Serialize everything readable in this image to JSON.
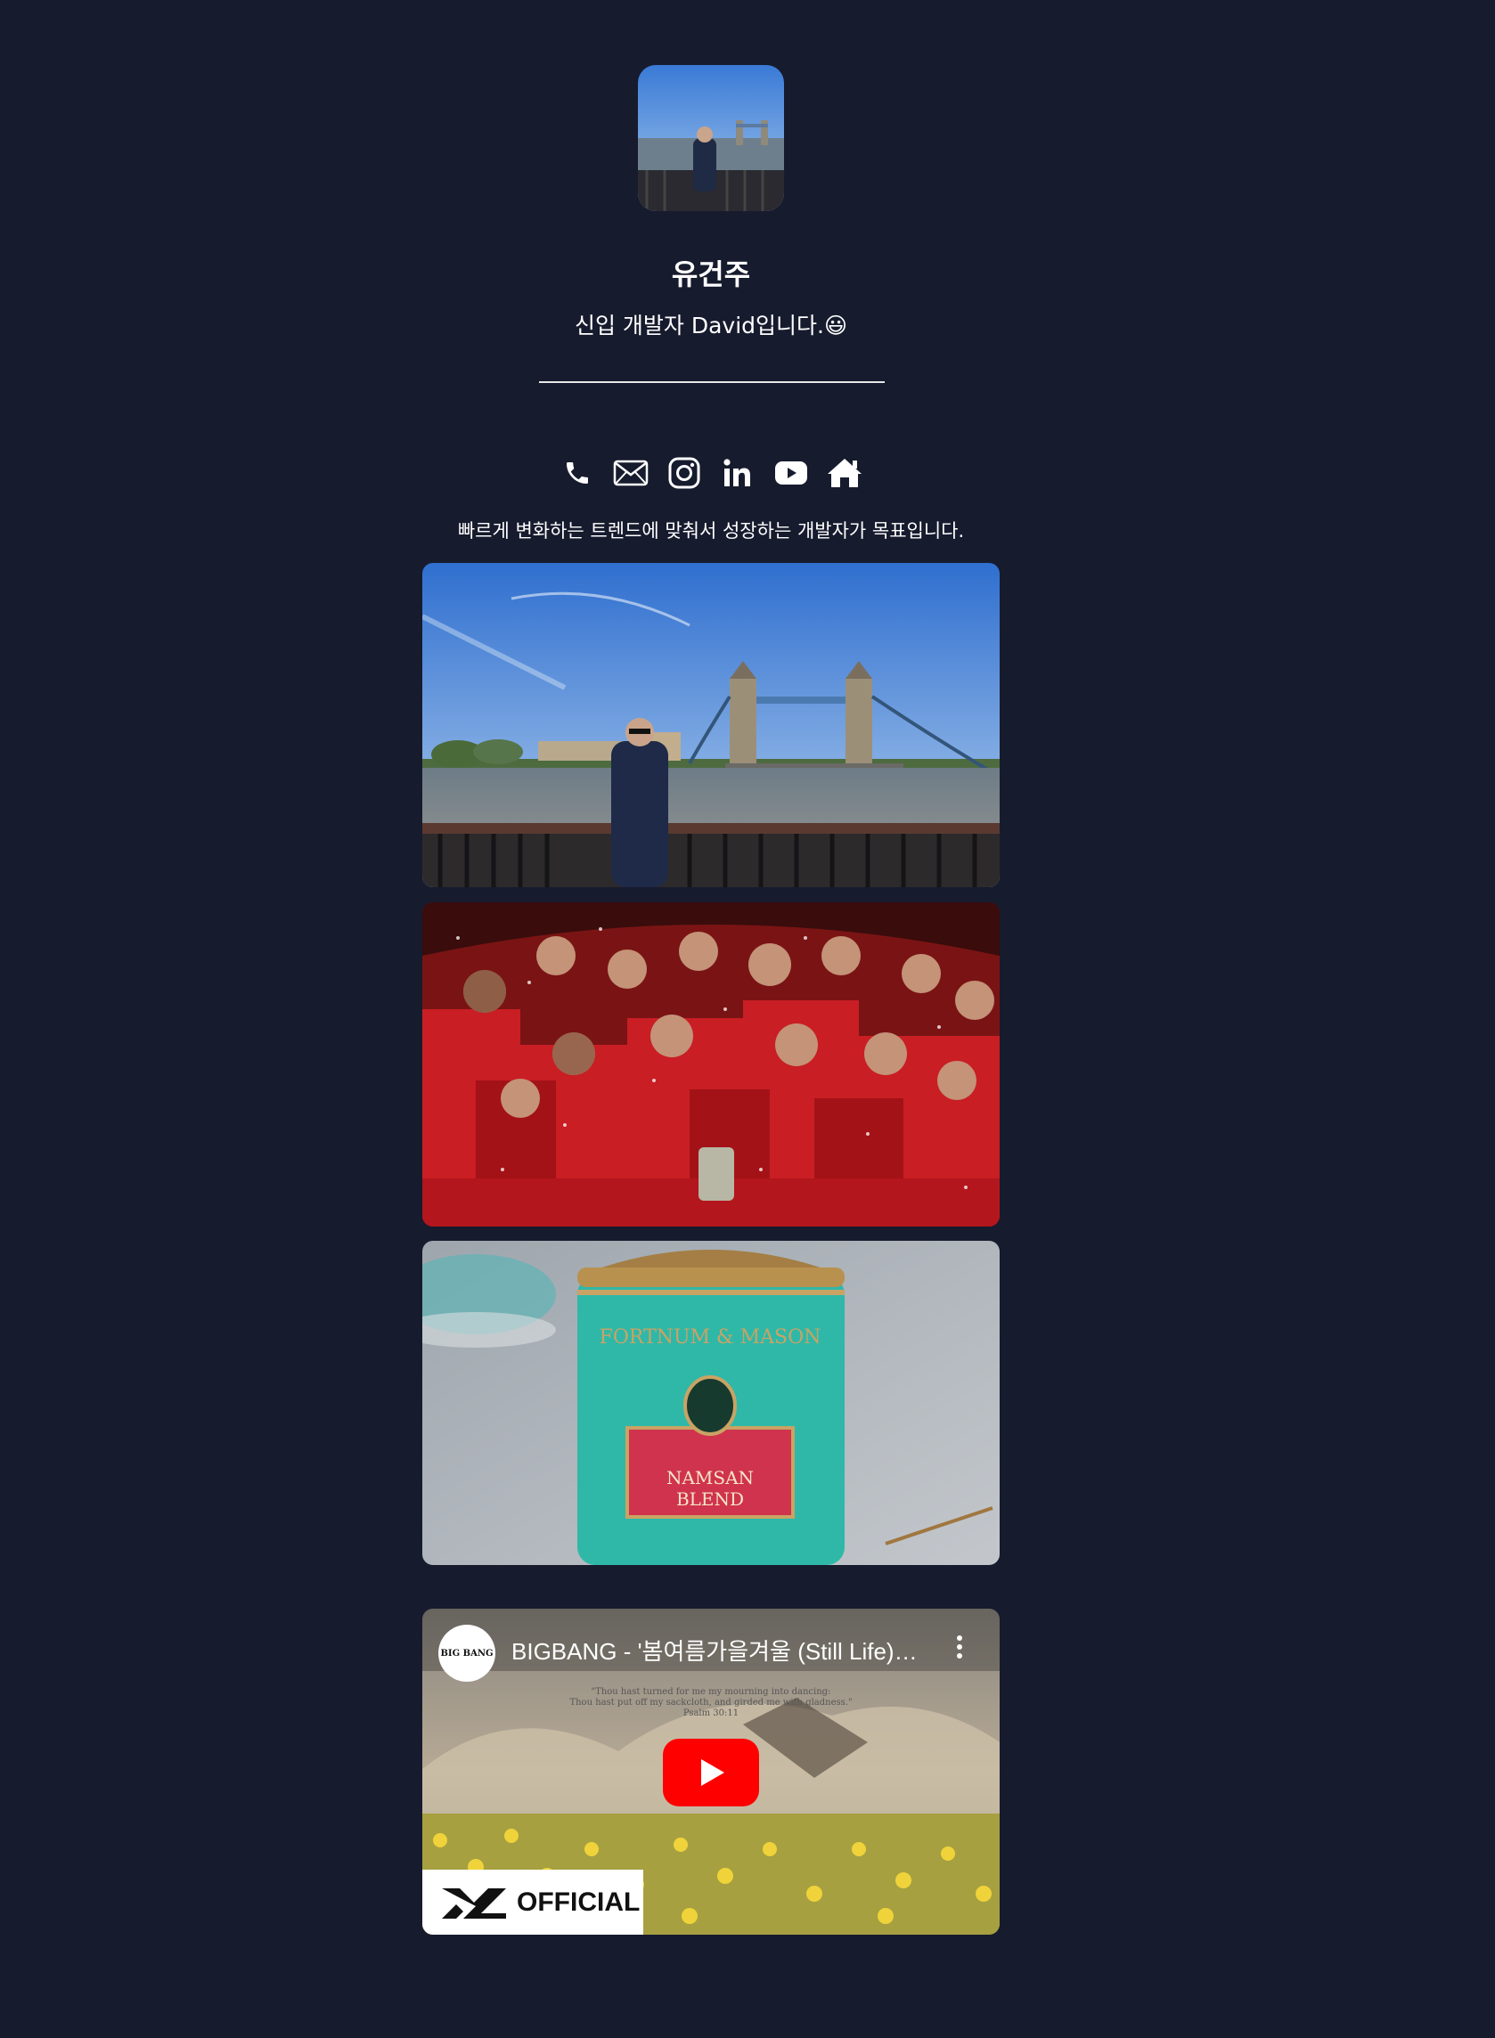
{
  "profile": {
    "name": "유건주",
    "intro": "신입 개발자 David입니다.😃"
  },
  "social_icons": [
    "phone-icon",
    "mail-icon",
    "instagram-icon",
    "linkedin-icon",
    "youtube-icon",
    "home-icon"
  ],
  "tagline": "빠르게 변화하는 트렌드에 맞춰서 성장하는 개발자가 목표입니다.",
  "photos": [
    {
      "name": "photo-tower-bridge"
    },
    {
      "name": "photo-team-celebration"
    },
    {
      "name": "photo-tea-tin",
      "text_top": "FORTNUM & MASON",
      "text_label_1": "NAMSAN",
      "text_label_2": "BLEND"
    }
  ],
  "video": {
    "channel_logo_text": "BIG BANG",
    "title": "BIGBANG - '봄여름가을겨울 (Still Life)' M/V",
    "quote_line_1": "\"Thou hast turned for me my mourning into dancing:",
    "quote_line_2": "Thou hast put off my sackcloth, and girded me with gladness.\"",
    "quote_line_3": "Psalm 30:11",
    "badge": "OFFICIAL"
  },
  "colors": {
    "background": "#171b2e",
    "youtube_red": "#ff0000"
  }
}
